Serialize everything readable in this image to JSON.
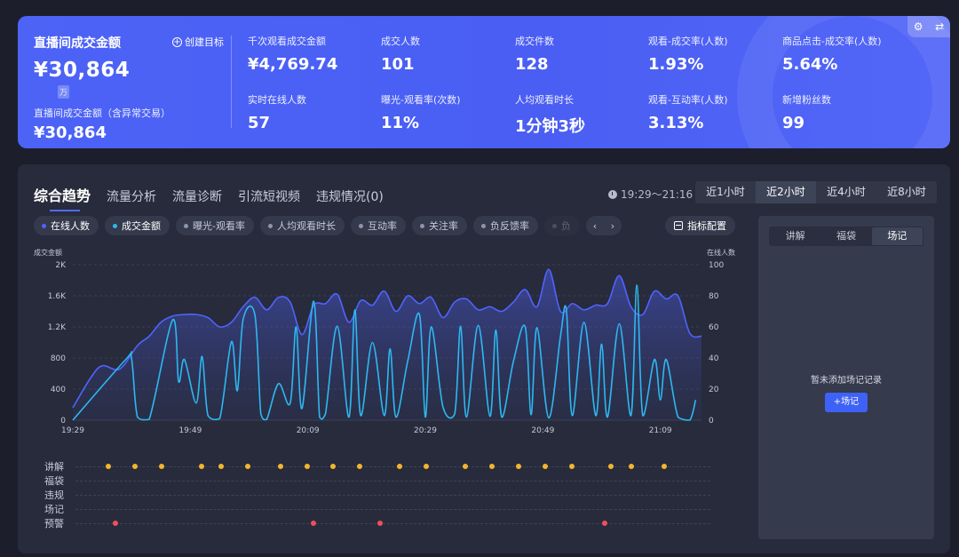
{
  "banner": {
    "primary_label": "直播间成交金额",
    "create_goal": "创建目标",
    "primary_value": "¥30,864",
    "unit_badge": "万",
    "secondary_label": "直播间成交金额（含异常交易）",
    "secondary_value": "¥30,864",
    "stats": [
      {
        "label": "千次观看成交金额",
        "value": "¥4,769.74"
      },
      {
        "label": "成交人数",
        "value": "101"
      },
      {
        "label": "成交件数",
        "value": "128"
      },
      {
        "label": "观看-成交率(人数)",
        "value": "1.93%"
      },
      {
        "label": "商品点击-成交率(人数)",
        "value": "5.64%"
      },
      {
        "label": "实时在线人数",
        "value": "57"
      },
      {
        "label": "曝光-观看率(次数)",
        "value": "11%"
      },
      {
        "label": "人均观看时长",
        "value": "1分钟3秒"
      },
      {
        "label": "观看-互动率(人数)",
        "value": "3.13%"
      },
      {
        "label": "新增粉丝数",
        "value": "99"
      }
    ],
    "corner_icons": [
      "settings-icon",
      "swap-icon"
    ]
  },
  "trend": {
    "tabs": [
      "综合趋势",
      "流量分析",
      "流量诊断",
      "引流短视频",
      "违规情况(0)"
    ],
    "time_range": "19:29～21:16",
    "ranges": [
      "近1小时",
      "近2小时",
      "近4小时",
      "近8小时"
    ],
    "active_range": "近2小时",
    "chips": [
      {
        "label": "在线人数",
        "on": true,
        "color": "#4f63ff"
      },
      {
        "label": "成交金额",
        "on": true,
        "color": "#2db8f0"
      },
      {
        "label": "曝光-观看率",
        "on": false,
        "color": "#8e95a8"
      },
      {
        "label": "人均观看时长",
        "on": false,
        "color": "#8e95a8"
      },
      {
        "label": "互动率",
        "on": false,
        "color": "#8e95a8"
      },
      {
        "label": "关注率",
        "on": false,
        "color": "#8e95a8"
      },
      {
        "label": "负反馈率",
        "on": false,
        "color": "#8e95a8"
      },
      {
        "label": "负",
        "on": false,
        "color": "#8e95a8"
      }
    ],
    "config_label": "指标配置",
    "side": {
      "segments": [
        "讲解",
        "福袋",
        "场记"
      ],
      "active_segment": "场记",
      "empty_text": "暂未添加场记记录",
      "add_button": "+场记"
    },
    "events": {
      "rows": [
        "讲解",
        "福袋",
        "违规",
        "场记",
        "预警"
      ],
      "explain_color": "#f5b52a",
      "warn_color": "#f0505a",
      "explain_times": [
        2.5,
        4.5,
        6.5,
        9.5,
        11,
        13,
        15.5,
        17.5,
        19.5,
        21.5,
        24.5,
        26.5,
        29.5,
        31.5,
        33.5,
        35.5,
        37.5,
        40.5,
        42,
        44.5
      ],
      "warn_times": [
        3,
        18,
        23,
        40
      ]
    }
  },
  "chart_data": {
    "type": "line",
    "title": "",
    "x_ticks": [
      "19:29",
      "19:49",
      "20:09",
      "20:29",
      "20:49",
      "21:09"
    ],
    "x_range": [
      0,
      107
    ],
    "left_axis": {
      "label": "成交金额",
      "ticks": [
        "0",
        "400",
        "800",
        "1.2K",
        "1.6K",
        "2K"
      ],
      "range": [
        0,
        2000
      ]
    },
    "right_axis": {
      "label": "在线人数",
      "ticks": [
        "0",
        "20",
        "40",
        "60",
        "80",
        "100"
      ],
      "range": [
        0,
        100
      ]
    },
    "series": [
      {
        "name": "在线人数",
        "axis": "right",
        "color": "#4f63ff",
        "x": [
          0,
          3,
          5,
          8,
          11,
          13,
          15,
          17,
          19,
          21,
          23,
          25,
          27,
          29,
          31,
          33,
          35,
          37,
          39,
          41,
          43,
          45,
          47,
          49,
          51,
          53,
          55,
          57,
          59,
          61,
          63,
          65,
          67,
          69,
          71,
          73,
          75,
          77,
          79,
          81,
          83,
          85,
          87,
          89,
          91,
          93,
          95,
          97,
          99,
          101,
          103,
          105,
          107
        ],
        "y": [
          8,
          27,
          35,
          33,
          48,
          54,
          63,
          67,
          68,
          68,
          66,
          60,
          63,
          73,
          79,
          71,
          79,
          76,
          55,
          74,
          75,
          81,
          63,
          77,
          74,
          83,
          70,
          80,
          75,
          79,
          66,
          76,
          78,
          71,
          73,
          70,
          76,
          84,
          73,
          97,
          70,
          75,
          71,
          74,
          75,
          93,
          73,
          68,
          83,
          78,
          80,
          56,
          54
        ]
      },
      {
        "name": "成交金额",
        "axis": "left",
        "color": "#2db8f0",
        "x": [
          0,
          9,
          10,
          11,
          13,
          17,
          18,
          19,
          21,
          22,
          23,
          25,
          27,
          28,
          29,
          31,
          32,
          33,
          35,
          37,
          38,
          39,
          41,
          42,
          43,
          45,
          47,
          48,
          49,
          51,
          53,
          54,
          55,
          57,
          59,
          60,
          61,
          63,
          65,
          66,
          67,
          69,
          71,
          72,
          73,
          75,
          77,
          78,
          79,
          81,
          83,
          84,
          85,
          87,
          89,
          90,
          91,
          93,
          95,
          96,
          97,
          99,
          100,
          101,
          103,
          105,
          106
        ],
        "y": [
          0,
          780,
          790,
          40,
          10,
          1290,
          500,
          780,
          220,
          820,
          60,
          20,
          1010,
          380,
          1300,
          1350,
          80,
          10,
          470,
          220,
          1200,
          150,
          1530,
          40,
          80,
          1210,
          40,
          1420,
          60,
          1000,
          60,
          920,
          40,
          760,
          1360,
          40,
          1200,
          170,
          80,
          1210,
          40,
          1220,
          50,
          1160,
          40,
          760,
          1200,
          70,
          1190,
          30,
          1080,
          1420,
          60,
          1260,
          60,
          980,
          40,
          1240,
          60,
          1740,
          60,
          780,
          260,
          780,
          40,
          0,
          260
        ]
      }
    ],
    "grid": true,
    "legend": "top-left"
  }
}
